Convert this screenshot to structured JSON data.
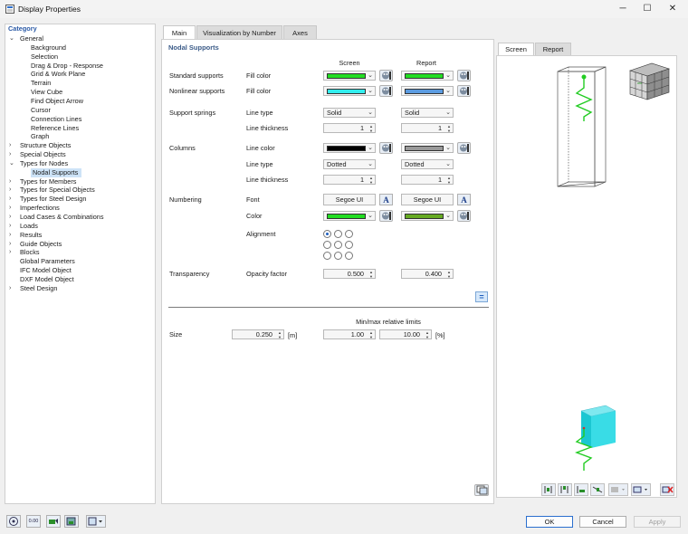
{
  "window": {
    "title": "Display Properties",
    "controls": [
      "─",
      "☐",
      "✕"
    ]
  },
  "category": {
    "header": "Category",
    "items": [
      {
        "label": "General",
        "level": 0,
        "caret": "expanded"
      },
      {
        "label": "Background",
        "level": 2
      },
      {
        "label": "Selection",
        "level": 2
      },
      {
        "label": "Drag & Drop - Response",
        "level": 2
      },
      {
        "label": "Grid & Work Plane",
        "level": 2
      },
      {
        "label": "Terrain",
        "level": 2
      },
      {
        "label": "View Cube",
        "level": 2
      },
      {
        "label": "Find Object Arrow",
        "level": 2
      },
      {
        "label": "Cursor",
        "level": 2
      },
      {
        "label": "Connection Lines",
        "level": 2
      },
      {
        "label": "Reference Lines",
        "level": 2
      },
      {
        "label": "Graph",
        "level": 2
      },
      {
        "label": "Structure Objects",
        "level": 0,
        "caret": "collapsed"
      },
      {
        "label": "Special Objects",
        "level": 0,
        "caret": "collapsed"
      },
      {
        "label": "Types for Nodes",
        "level": 0,
        "caret": "expanded"
      },
      {
        "label": "Nodal Supports",
        "level": 2,
        "selected": true
      },
      {
        "label": "Types for Members",
        "level": 0,
        "caret": "collapsed"
      },
      {
        "label": "Types for Special Objects",
        "level": 0,
        "caret": "collapsed"
      },
      {
        "label": "Types for Steel Design",
        "level": 0,
        "caret": "collapsed"
      },
      {
        "label": "Imperfections",
        "level": 0,
        "caret": "collapsed"
      },
      {
        "label": "Load Cases & Combinations",
        "level": 0,
        "caret": "collapsed"
      },
      {
        "label": "Loads",
        "level": 0,
        "caret": "collapsed"
      },
      {
        "label": "Results",
        "level": 0,
        "caret": "collapsed"
      },
      {
        "label": "Guide Objects",
        "level": 0,
        "caret": "collapsed"
      },
      {
        "label": "Blocks",
        "level": 0,
        "caret": "collapsed"
      },
      {
        "label": "Global Parameters",
        "level": 1
      },
      {
        "label": "IFC Model Object",
        "level": 1
      },
      {
        "label": "DXF Model Object",
        "level": 1
      },
      {
        "label": "Steel Design",
        "level": 0,
        "caret": "collapsed"
      }
    ]
  },
  "tabs": [
    "Main",
    "Visualization by Number",
    "Axes"
  ],
  "main": {
    "section_title": "Nodal Supports",
    "col_screen": "Screen",
    "col_report": "Report",
    "standard_supports": {
      "label": "Standard supports",
      "prop": "Fill color",
      "screen_color": "#22dd22",
      "report_color": "#22dd22"
    },
    "nonlinear_supports": {
      "label": "Nonlinear supports",
      "prop": "Fill color",
      "screen_color": "#33eeee",
      "report_color": "#5b9be0"
    },
    "support_springs": {
      "label": "Support springs",
      "line_type_label": "Line type",
      "screen_type": "Solid",
      "report_type": "Solid",
      "thickness_label": "Line thickness",
      "screen_thickness": "1",
      "report_thickness": "1"
    },
    "columns": {
      "label": "Columns",
      "color_label": "Line color",
      "screen_color": "#000000",
      "report_color": "#999999",
      "line_type_label": "Line type",
      "screen_type": "Dotted",
      "report_type": "Dotted",
      "thickness_label": "Line thickness",
      "screen_thickness": "1",
      "report_thickness": "1"
    },
    "numbering": {
      "label": "Numbering",
      "font_label": "Font",
      "screen_font": "Segoe UI",
      "report_font": "Segoe UI",
      "font_icon": "A",
      "color_label": "Color",
      "screen_color": "#22dd22",
      "report_color": "#66aa22",
      "alignment_label": "Alignment",
      "alignment_selected": 0
    },
    "transparency": {
      "label": "Transparency",
      "prop": "Opacity factor",
      "screen_value": "0.500",
      "report_value": "0.400"
    },
    "equals_icon": "=",
    "limits_header": "Min/max relative limits",
    "size": {
      "label": "Size",
      "value": "0.250",
      "unit": "[m]",
      "min": "1.00",
      "max": "10.00",
      "percent": "[%]"
    }
  },
  "preview": {
    "tabs": [
      "Screen",
      "Report"
    ]
  },
  "footer": {
    "ok": "OK",
    "cancel": "Cancel",
    "apply": "Apply",
    "value_icon": "0.00"
  }
}
